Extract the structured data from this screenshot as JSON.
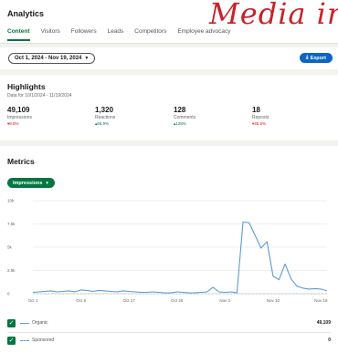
{
  "header": {
    "title": "Analytics",
    "watermark": "Media in",
    "tabs": [
      {
        "label": "Content",
        "active": true
      },
      {
        "label": "Visitors",
        "active": false
      },
      {
        "label": "Followers",
        "active": false
      },
      {
        "label": "Leads",
        "active": false
      },
      {
        "label": "Competitors",
        "active": false
      },
      {
        "label": "Employee advocacy",
        "active": false
      }
    ]
  },
  "filters": {
    "date_range": "Oct 1, 2024 - Nov 19, 2024",
    "export_label": "Export"
  },
  "highlights": {
    "title": "Highlights",
    "subtitle": "Data for 10/1/2024 - 11/19/2024",
    "metrics": [
      {
        "value": "49,109",
        "label": "Impressions",
        "change": "▾8.5%",
        "direction": "down"
      },
      {
        "value": "1,320",
        "label": "Reactions",
        "change": "▴66.9%",
        "direction": "up"
      },
      {
        "value": "128",
        "label": "Comments",
        "change": "▴128%",
        "direction": "up"
      },
      {
        "value": "18",
        "label": "Reposts",
        "change": "▾45.5%",
        "direction": "down"
      }
    ]
  },
  "metrics": {
    "title": "Metrics",
    "dropdown_label": "Impressions",
    "legend": [
      {
        "name": "Organic",
        "value": "49,109",
        "style": "solid"
      },
      {
        "name": "Sponsored",
        "value": "0",
        "style": "dashed"
      }
    ]
  },
  "colors": {
    "accent_green": "#057642",
    "primary_blue": "#0a66c2",
    "line_blue": "#5b9bd5"
  },
  "chart_data": {
    "type": "line",
    "xlabel": "",
    "ylabel": "",
    "ylim": [
      0,
      10000
    ],
    "yticks": [
      0,
      2500,
      5000,
      7500,
      10000
    ],
    "ytick_labels": [
      "0",
      "2.5k",
      "5k",
      "7.5k",
      "10k"
    ],
    "xtick_labels": [
      "Oct 1",
      "Oct 9",
      "Oct 17",
      "Oct 25",
      "Nov 2",
      "Nov 10",
      "Nov 18"
    ],
    "grid": true,
    "x": [
      "Oct 1",
      "Oct 2",
      "Oct 3",
      "Oct 4",
      "Oct 5",
      "Oct 6",
      "Oct 7",
      "Oct 8",
      "Oct 9",
      "Oct 10",
      "Oct 11",
      "Oct 12",
      "Oct 13",
      "Oct 14",
      "Oct 15",
      "Oct 16",
      "Oct 17",
      "Oct 18",
      "Oct 19",
      "Oct 20",
      "Oct 21",
      "Oct 22",
      "Oct 23",
      "Oct 24",
      "Oct 25",
      "Oct 26",
      "Oct 27",
      "Oct 28",
      "Oct 29",
      "Oct 30",
      "Oct 31",
      "Nov 1",
      "Nov 2",
      "Nov 3",
      "Nov 4",
      "Nov 5",
      "Nov 6",
      "Nov 7",
      "Nov 8",
      "Nov 9",
      "Nov 10",
      "Nov 11",
      "Nov 12",
      "Nov 13",
      "Nov 14",
      "Nov 15",
      "Nov 16",
      "Nov 17",
      "Nov 18",
      "Nov 19"
    ],
    "series": [
      {
        "name": "Organic",
        "values": [
          150,
          200,
          250,
          300,
          200,
          250,
          300,
          200,
          400,
          350,
          250,
          350,
          300,
          250,
          200,
          300,
          250,
          200,
          150,
          150,
          200,
          150,
          100,
          100,
          200,
          150,
          100,
          100,
          150,
          200,
          700,
          200,
          150,
          200,
          100,
          7700,
          7650,
          6300,
          4900,
          5600,
          1900,
          1500,
          3200,
          1600,
          800,
          600,
          500,
          550,
          500,
          300
        ]
      },
      {
        "name": "Sponsored",
        "values": [
          0,
          0,
          0,
          0,
          0,
          0,
          0,
          0,
          0,
          0,
          0,
          0,
          0,
          0,
          0,
          0,
          0,
          0,
          0,
          0,
          0,
          0,
          0,
          0,
          0,
          0,
          0,
          0,
          0,
          0,
          0,
          0,
          0,
          0,
          0,
          0,
          0,
          0,
          0,
          0,
          0,
          0,
          0,
          0,
          0,
          0,
          0,
          0,
          0,
          0
        ]
      }
    ]
  }
}
